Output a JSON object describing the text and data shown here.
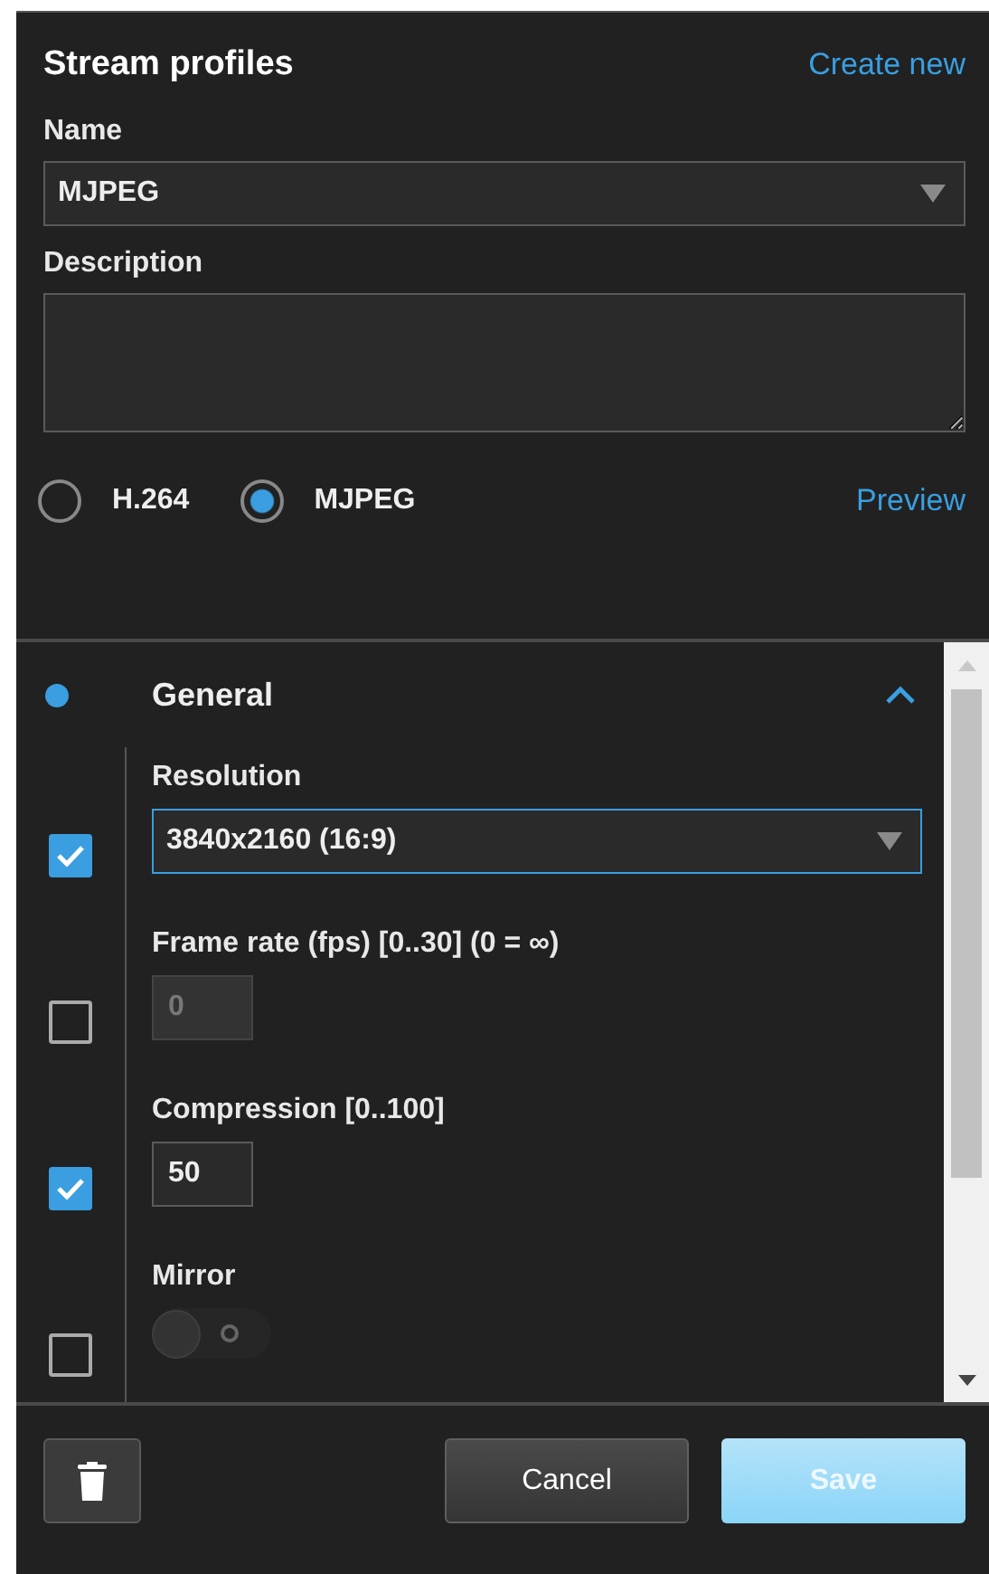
{
  "panel": {
    "title": "Stream profiles",
    "create_link": "Create new"
  },
  "name_field": {
    "label": "Name",
    "value": "MJPEG"
  },
  "description_field": {
    "label": "Description"
  },
  "encodings": [
    {
      "label": "H.264",
      "selected": false
    },
    {
      "label": "MJPEG",
      "selected": true
    }
  ],
  "preview_link": "Preview",
  "section": {
    "title": "General",
    "expanded": true,
    "settings": [
      {
        "kind": "select",
        "label": "Resolution",
        "value": "3840x2160 (16:9)",
        "checked": true,
        "focused": true
      },
      {
        "kind": "number",
        "label": "Frame rate (fps) [0..30] (0 = ∞)",
        "value": "0",
        "checked": false,
        "disabled": true
      },
      {
        "kind": "number",
        "label": "Compression [0..100]",
        "value": "50",
        "checked": true,
        "disabled": false
      },
      {
        "kind": "toggle",
        "label": "Mirror",
        "checked": false,
        "on": false
      }
    ]
  },
  "buttons": {
    "cancel": "Cancel",
    "save": "Save",
    "save_disabled": true
  }
}
